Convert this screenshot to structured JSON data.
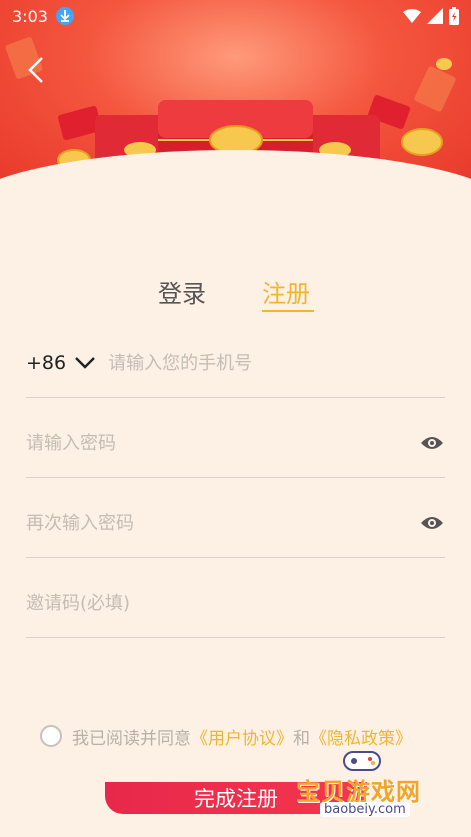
{
  "status_bar": {
    "time": "3:03"
  },
  "tabs": {
    "login": "登录",
    "register": "注册"
  },
  "form": {
    "country_code": "+86",
    "phone_placeholder": "请输入您的手机号",
    "password_placeholder": "请输入密码",
    "password_confirm_placeholder": "再次输入密码",
    "invite_placeholder": "邀请码(必填)"
  },
  "agreement": {
    "prefix": "我已阅读并同意",
    "user_agreement": "《用户协议》",
    "and": "和",
    "privacy_policy": "《隐私政策》"
  },
  "submit_label": "完成注册",
  "watermark": {
    "title": "宝贝游戏网",
    "url": "baobeiy.com"
  },
  "colors": {
    "accent": "#f2b531",
    "button": "#e8284a",
    "background": "#fdf0e4"
  }
}
